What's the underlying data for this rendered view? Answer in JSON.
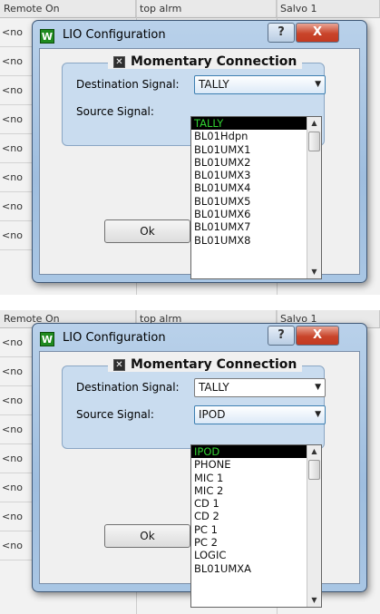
{
  "panels": [
    {
      "grid": {
        "headers": [
          "Remote On",
          "top alrm",
          "Salvo 1"
        ],
        "rows": [
          "<no",
          "<no",
          "<no",
          "<no",
          "<no",
          "<no",
          "<no",
          "<no"
        ]
      },
      "dialog": {
        "title": "LIO Configuration",
        "help_label": "?",
        "close_label": "X",
        "group_title": "Momentary Connection",
        "checkbox_mark": "✕",
        "dest_label": "Destination Signal:",
        "dest_value": "TALLY",
        "source_label": "Source Signal:",
        "source_value": "",
        "ok_label": "Ok",
        "dropdown": {
          "for": "destination",
          "items": [
            "TALLY",
            "BL01Hdpn",
            "BL01UMX1",
            "BL01UMX2",
            "BL01UMX3",
            "BL01UMX4",
            "BL01UMX5",
            "BL01UMX6",
            "BL01UMX7",
            "BL01UMX8"
          ],
          "selected": "TALLY"
        }
      }
    },
    {
      "grid": {
        "headers": [
          "Remote On",
          "top alrm",
          "Salvo 1"
        ],
        "rows": [
          "<no",
          "<no",
          "<no",
          "<no",
          "<no",
          "<no",
          "<no",
          "<no"
        ]
      },
      "dialog": {
        "title": "LIO Configuration",
        "help_label": "?",
        "close_label": "X",
        "group_title": "Momentary Connection",
        "checkbox_mark": "✕",
        "dest_label": "Destination Signal:",
        "dest_value": "TALLY",
        "source_label": "Source Signal:",
        "source_value": "IPOD",
        "ok_label": "Ok",
        "dropdown": {
          "for": "source",
          "items": [
            "IPOD",
            "PHONE",
            "MIC 1",
            "MIC 2",
            "CD 1",
            "CD 2",
            "PC 1",
            "PC 2",
            "LOGIC",
            "BL01UMXA"
          ],
          "selected": "IPOD"
        }
      }
    }
  ],
  "colors": {
    "selected_bg": "#000000",
    "selected_text": "#32d232",
    "title_gradient": "#b9d1ea",
    "close_red": "#c9452b",
    "group_bg": "#c9dcef"
  }
}
